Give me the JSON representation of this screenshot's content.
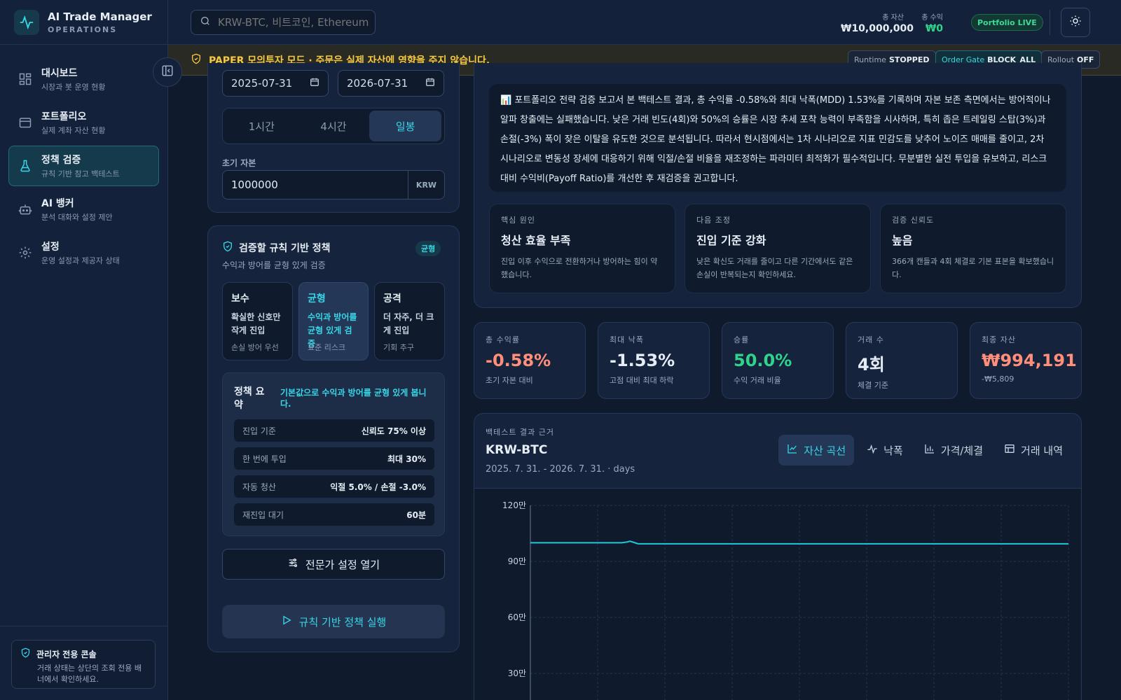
{
  "brand": {
    "title": "AI Trade Manager",
    "subtitle": "OPERATIONS"
  },
  "nav": [
    {
      "label": "대시보드",
      "sub": "시장과 봇 운영 현황",
      "icon": "dashboard-icon",
      "active": false
    },
    {
      "label": "포트폴리오",
      "sub": "실제 계좌 자산 현황",
      "icon": "wallet-icon",
      "active": false
    },
    {
      "label": "정책 검증",
      "sub": "규칙 기반 참고 백테스트",
      "icon": "flask-icon",
      "active": true
    },
    {
      "label": "AI 뱅커",
      "sub": "분석 대화와 설정 제안",
      "icon": "robot-icon",
      "active": false
    },
    {
      "label": "설정",
      "sub": "운영 설정과 제공자 상태",
      "icon": "gear-icon",
      "active": false
    }
  ],
  "admin": {
    "title": "관리자 전용 콘솔",
    "desc": "거래 상태는 상단의 조회 전용 배너에서 확인하세요."
  },
  "search": {
    "placeholder": "KRW-BTC, 비트코인, Ethereum"
  },
  "top_stats": {
    "total_assets_label": "총 자산",
    "total_assets": "₩10,000,000",
    "total_profit_label": "총 수익",
    "total_profit": "₩0",
    "portfolio_badge": "Portfolio LIVE"
  },
  "banner": {
    "text": "PAPER 모의투자 모드 · 주문은 실제 자산에 영향을 주지 않습니다.",
    "runtime_label": "Runtime",
    "runtime_value": "STOPPED",
    "gate_label": "Order Gate",
    "gate_value": "BLOCK_ALL",
    "rollout_label": "Rollout",
    "rollout_value": "OFF"
  },
  "backtest_form": {
    "start_date": "2025-07-31",
    "end_date": "2026-07-31",
    "timeframes": [
      "1시간",
      "4시간",
      "일봉"
    ],
    "active_timeframe": 2,
    "capital_label": "초기 자본",
    "capital_value": "1000000",
    "capital_unit": "KRW"
  },
  "policy": {
    "title": "검증할 규칙 기반 정책",
    "subtitle": "수익과 방어를 균형 있게 검증",
    "badge": "균형",
    "modes": [
      {
        "name": "보수",
        "desc": "확실한 신호만 작게 진입",
        "foot": "손실 방어 우선"
      },
      {
        "name": "균형",
        "desc": "수익과 방어를 균형 있게 검증",
        "foot": "표준 리스크"
      },
      {
        "name": "공격",
        "desc": "더 자주, 더 크게 진입",
        "foot": "기회 추구"
      }
    ],
    "summary_title": "정책 요약",
    "summary_desc": "기본값으로 수익과 방어를 균형 있게 봅니다.",
    "rows": [
      {
        "k": "진입 기준",
        "v": "신뢰도 75% 이상"
      },
      {
        "k": "한 번에 투입",
        "v": "최대 30%"
      },
      {
        "k": "자동 청산",
        "v": "익절 5.0% / 손절 -3.0%"
      },
      {
        "k": "재진입 대기",
        "v": "60분"
      }
    ],
    "expert_button": "전문가 설정 열기",
    "run_button": "규칙 기반 정책 실행"
  },
  "report": {
    "icon": "📊",
    "text": "포트폴리오 전략 검증 보고서 본 백테스트 결과, 총 수익률 -0.58%와 최대 낙폭(MDD) 1.53%를 기록하며 자본 보존 측면에서는 방어적이나 알파 창출에는 실패했습니다. 낮은 거래 빈도(4회)와 50%의 승률은 시장 추세 포착 능력이 부족함을 시사하며, 특히 좁은 트레일링 스탑(3%)과 손절(-3%) 폭이 잦은 이탈을 유도한 것으로 분석됩니다. 따라서 현시점에서는 1차 시나리오로 지표 민감도를 낮추어 노이즈 매매를 줄이고, 2차 시나리오로 변동성 장세에 대응하기 위해 익절/손절 비율을 재조정하는 파라미터 최적화가 필수적입니다. 무분별한 실전 투입을 유보하고, 리스크 대비 수익비(Payoff Ratio)를 개선한 후 재검증을 권고합니다.",
    "insights": [
      {
        "label": "핵심 원인",
        "title": "청산 효율 부족",
        "desc": "진입 이후 수익으로 전환하거나 방어하는 힘이 약했습니다."
      },
      {
        "label": "다음 조정",
        "title": "진입 기준 강화",
        "desc": "낮은 확신도 거래를 줄이고 다른 기간에서도 같은 손실이 반복되는지 확인하세요."
      },
      {
        "label": "검증 신뢰도",
        "title": "높음",
        "desc": "366개 캔들과 4회 체결로 기본 표본을 확보했습니다."
      }
    ]
  },
  "kpis": [
    {
      "label": "총 수익률",
      "value": "-0.58%",
      "sub": "초기 자본 대비",
      "tone": "red"
    },
    {
      "label": "최대 낙폭",
      "value": "-1.53%",
      "sub": "고점 대비 최대 하락",
      "tone": "white"
    },
    {
      "label": "승률",
      "value": "50.0%",
      "sub": "수익 거래 비율",
      "tone": "green"
    },
    {
      "label": "거래 수",
      "value": "4회",
      "sub": "체결 기준",
      "tone": "white"
    },
    {
      "label": "최종 자산",
      "value": "₩994,191",
      "sub": "-₩5,809",
      "tone": "red"
    }
  ],
  "chart_panel": {
    "eyebrow": "백테스트 결과 근거",
    "title": "KRW-BTC",
    "subtitle": "2025. 7. 31. - 2026. 7. 31. · days",
    "tabs": [
      {
        "label": "자산 곡선",
        "icon": "line-chart-icon",
        "active": true
      },
      {
        "label": "낙폭",
        "icon": "activity-icon",
        "active": false
      },
      {
        "label": "가격/체결",
        "icon": "bar-chart-icon",
        "active": false
      },
      {
        "label": "거래 내역",
        "icon": "table-icon",
        "active": false
      }
    ]
  },
  "chart_data": {
    "type": "line",
    "y_ticks": [
      {
        "value": 1200000,
        "label": "120만"
      },
      {
        "value": 900000,
        "label": "90만"
      },
      {
        "value": 600000,
        "label": "60만"
      },
      {
        "value": 300000,
        "label": "30만"
      }
    ],
    "ylim": [
      0,
      1200000
    ],
    "grid": true,
    "series": [
      {
        "color": "#22c7d6",
        "x": [
          0,
          0.17,
          0.18,
          0.185,
          0.19,
          0.2,
          0.21,
          1.0
        ],
        "values": [
          1000000,
          1000000,
          1004000,
          1008000,
          1004000,
          994191,
          994191,
          994191
        ]
      }
    ]
  }
}
